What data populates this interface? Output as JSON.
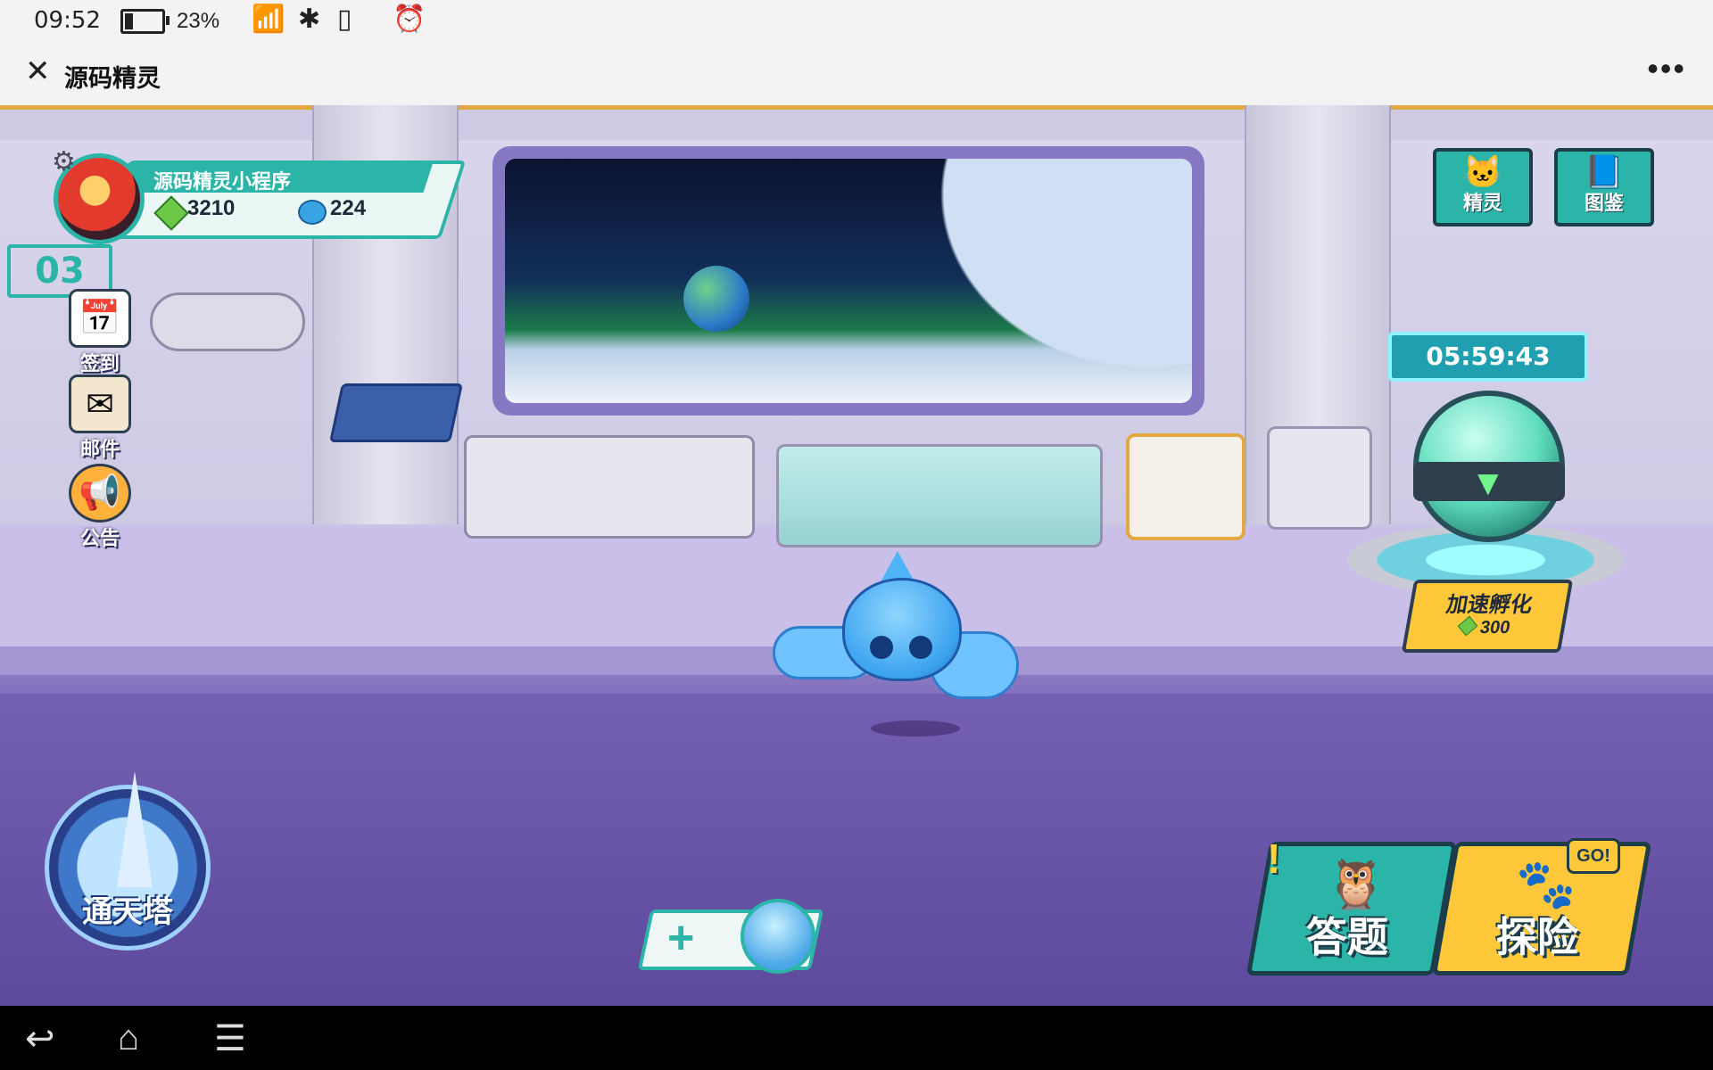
{
  "status_bar": {
    "time": "09:52",
    "battery_percent": "23%",
    "battery_level": 0.23,
    "icons": [
      "wifi-icon",
      "bluetooth-icon",
      "vibrate-icon",
      "alarm-icon"
    ]
  },
  "title_bar": {
    "title": "源码精灵",
    "close_icon": "close-icon",
    "more_icon": "more-icon"
  },
  "profile": {
    "name": "源码精灵小程序",
    "gems": "3210",
    "orbs": "224",
    "level": "03"
  },
  "side_menu": [
    {
      "label": "签到",
      "icon": "calendar-icon"
    },
    {
      "label": "邮件",
      "icon": "mail-icon"
    },
    {
      "label": "公告",
      "icon": "megaphone-icon"
    }
  ],
  "top_right": [
    {
      "label": "精灵",
      "icon": "cat-face-icon"
    },
    {
      "label": "图鉴",
      "icon": "book-icon"
    }
  ],
  "incubator": {
    "timer": "05:59:43",
    "speedup_label": "加速孵化",
    "speedup_cost": "300"
  },
  "tower": {
    "label": "通天塔"
  },
  "actions": {
    "quiz_label": "答题",
    "explore_label": "探险",
    "go_badge": "GO!",
    "alert": "!"
  },
  "colors": {
    "accent": "#2bb5a8",
    "gold": "#ffc83a",
    "floor": "#6852a3"
  }
}
